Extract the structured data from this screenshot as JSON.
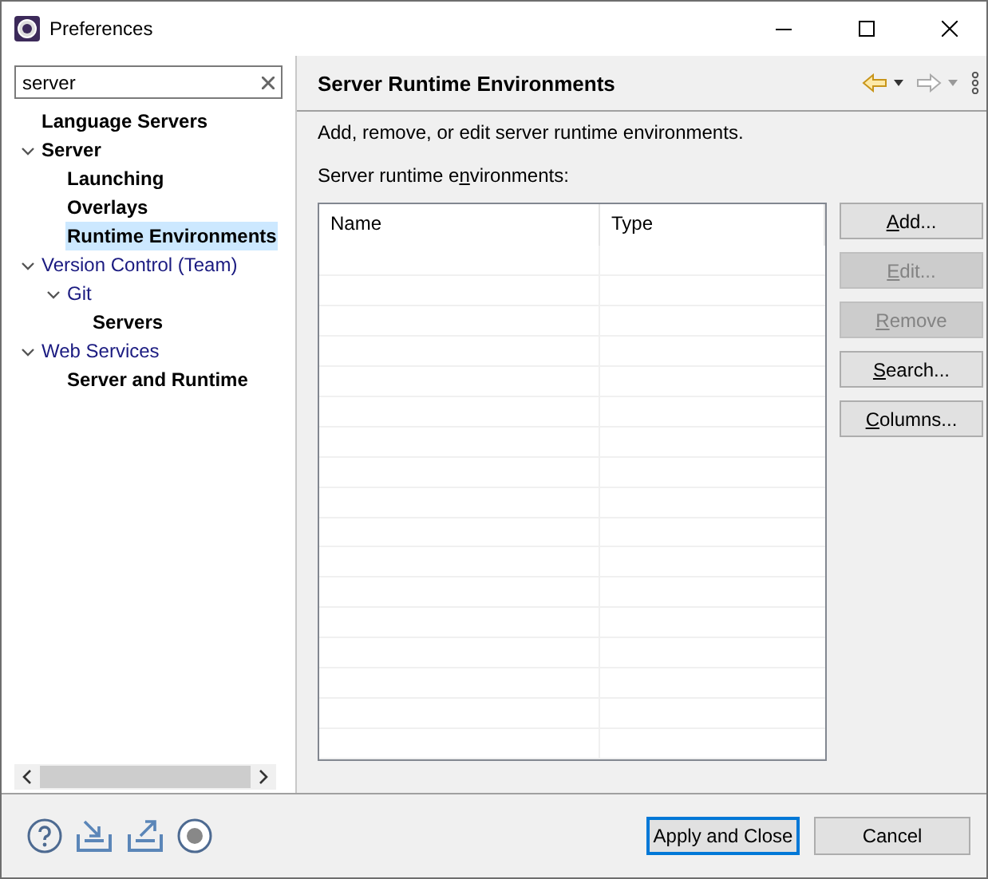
{
  "window": {
    "title": "Preferences"
  },
  "filter": {
    "value": "server"
  },
  "tree": [
    {
      "label": "Language Servers",
      "matched": true,
      "selected": false
    },
    {
      "label": "Server",
      "matched": true,
      "selected": false,
      "expanded": true,
      "children": [
        {
          "label": "Launching",
          "matched": true,
          "selected": false
        },
        {
          "label": "Overlays",
          "matched": true,
          "selected": false
        },
        {
          "label": "Runtime Environments",
          "matched": true,
          "selected": true
        }
      ]
    },
    {
      "label": "Version Control (Team)",
      "matched": false,
      "selected": false,
      "expanded": true,
      "children": [
        {
          "label": "Git",
          "matched": false,
          "selected": false,
          "expanded": true,
          "children": [
            {
              "label": "Servers",
              "matched": true,
              "selected": false
            }
          ]
        }
      ]
    },
    {
      "label": "Web Services",
      "matched": false,
      "selected": false,
      "expanded": true,
      "children": [
        {
          "label": "Server and Runtime",
          "matched": true,
          "selected": false
        }
      ]
    }
  ],
  "page": {
    "title": "Server Runtime Environments",
    "description": "Add, remove, or edit server runtime environments.",
    "list_label": {
      "pre": "Server runtime e",
      "key": "n",
      "post": "vironments:"
    },
    "columns": [
      "Name",
      "Type"
    ],
    "button_groups": [
      [
        {
          "key": "A",
          "post": "dd...",
          "disabled": false
        },
        {
          "key": "E",
          "post": "dit...",
          "disabled": true
        },
        {
          "key": "R",
          "post": "emove",
          "disabled": true
        }
      ],
      [
        {
          "key": "S",
          "post": "earch...",
          "disabled": false
        },
        {
          "key": "C",
          "post": "olumns...",
          "disabled": false
        }
      ]
    ]
  },
  "footer": {
    "buttons": [
      {
        "label": "Apply and Close",
        "default": true
      },
      {
        "label": "Cancel",
        "default": false
      }
    ]
  }
}
